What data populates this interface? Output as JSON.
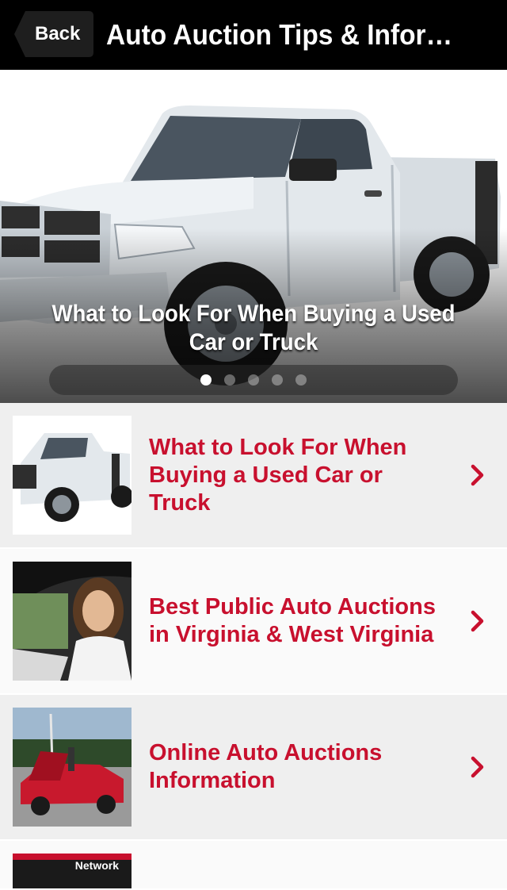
{
  "navbar": {
    "back_label": "Back",
    "title": "Auto Auction Tips & Information"
  },
  "hero": {
    "caption": "What to Look For When Buying a Used Car or Truck",
    "page_count": 5,
    "active_page": 1
  },
  "articles": [
    {
      "title": "What to Look For When Buying a Used Car or Truck",
      "thumb": "white-pickup-truck"
    },
    {
      "title": "Best Public Auto Auctions in Virginia & West Virginia",
      "thumb": "woman-driving-car"
    },
    {
      "title": "Online Auto Auctions Information",
      "thumb": "red-classic-car"
    },
    {
      "title": "",
      "thumb_text": "Network",
      "thumb": "network-logo"
    }
  ],
  "colors": {
    "navbar_bg": "#000000",
    "accent_red": "#c8102e",
    "row_bg": "#efefef"
  }
}
